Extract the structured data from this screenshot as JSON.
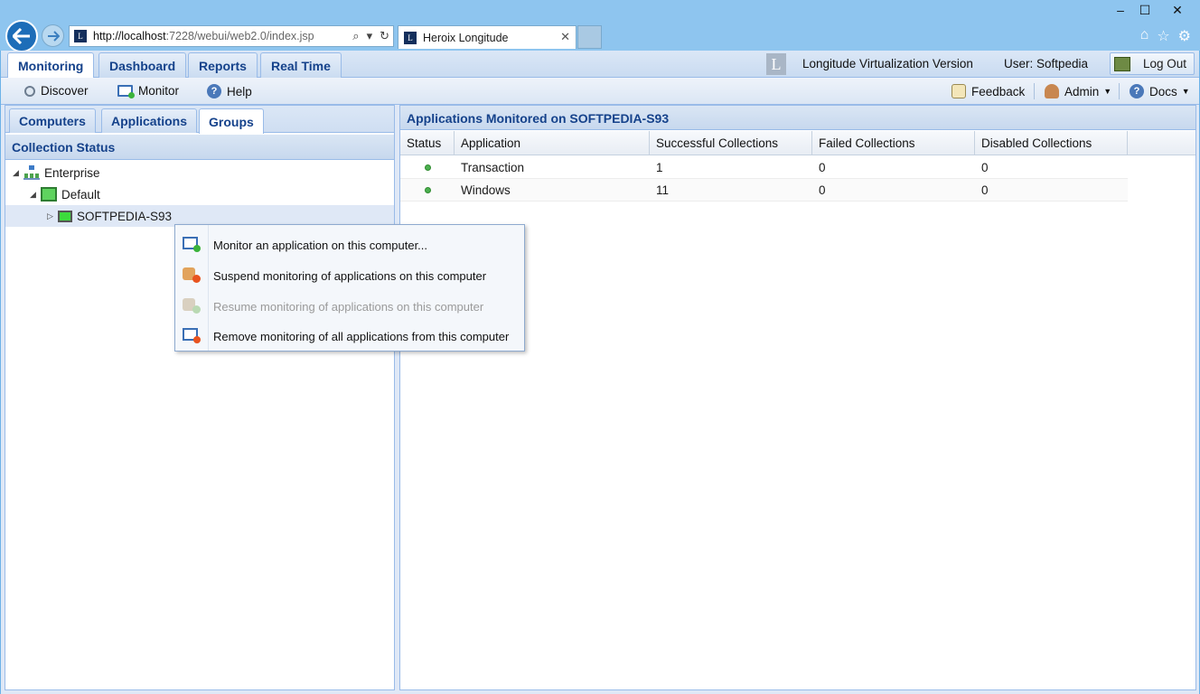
{
  "browser": {
    "url_host": "http://localhost",
    "url_rest": ":7228/webui/web2.0/index.jsp",
    "tab_title": "Heroix Longitude",
    "favicon_letter": "L",
    "window_controls": {
      "minimize": "–",
      "maximize": "☐",
      "close": "✕"
    }
  },
  "header": {
    "tabs": [
      {
        "label": "Monitoring",
        "active": true
      },
      {
        "label": "Dashboard",
        "active": false
      },
      {
        "label": "Reports",
        "active": false
      },
      {
        "label": "Real Time",
        "active": false
      }
    ],
    "logo_letter": "L",
    "product": "Longitude Virtualization Version",
    "user": "User: Softpedia",
    "logout": "Log Out"
  },
  "toolbar": {
    "discover": "Discover",
    "monitor": "Monitor",
    "help": "Help",
    "feedback": "Feedback",
    "admin": "Admin",
    "docs": "Docs"
  },
  "left_panel": {
    "tabs": [
      {
        "label": "Computers",
        "active": false
      },
      {
        "label": "Applications",
        "active": false
      },
      {
        "label": "Groups",
        "active": true
      }
    ],
    "title": "Collection Status",
    "tree": [
      {
        "label": "Enterprise",
        "icon": "enterprise-icon"
      },
      {
        "label": "Default",
        "icon": "group-icon"
      },
      {
        "label": "SOFTPEDIA-S93",
        "icon": "computer-icon",
        "selected": true
      }
    ]
  },
  "right_panel": {
    "title": "Applications Monitored on SOFTPEDIA-S93",
    "columns": [
      "Status",
      "Application",
      "Successful Collections",
      "Failed Collections",
      "Disabled Collections"
    ],
    "rows": [
      {
        "status": "ok",
        "application": "Transaction",
        "successful": "1",
        "failed": "0",
        "disabled": "0"
      },
      {
        "status": "ok",
        "application": "Windows",
        "successful": "11",
        "failed": "0",
        "disabled": "0"
      }
    ]
  },
  "context_menu": {
    "items": [
      {
        "label": "Monitor an application on this computer...",
        "enabled": true
      },
      {
        "label": "Suspend monitoring of applications on this computer",
        "enabled": true
      },
      {
        "label": "Resume monitoring of applications on this computer",
        "enabled": false
      },
      {
        "label": "Remove monitoring of all applications from this computer",
        "enabled": true
      }
    ]
  },
  "colors": {
    "accent": "#15428b",
    "status_ok": "#4caf50",
    "chrome": "#8ec5ef"
  }
}
